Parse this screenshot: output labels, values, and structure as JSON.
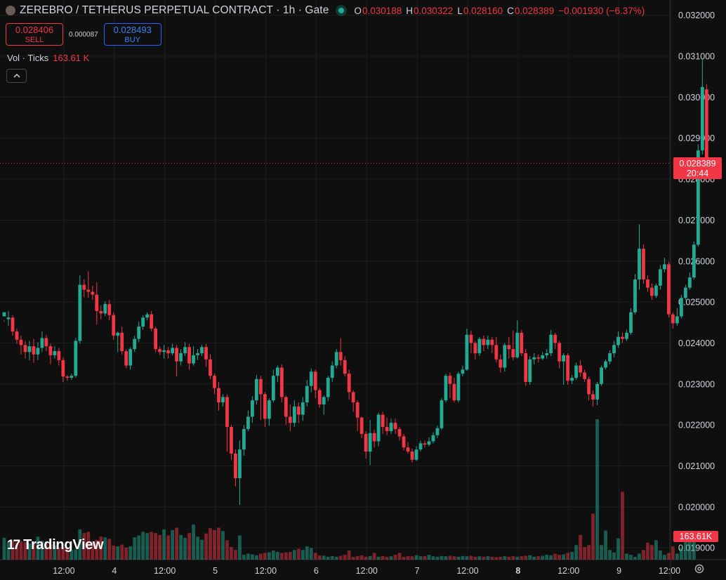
{
  "header": {
    "title": "ZEREBRO / TETHERUS PERPETUAL CONTRACT · 1h · Gate",
    "ohlc": {
      "o_label": "O",
      "o": "0.030188",
      "h_label": "H",
      "h": "0.030322",
      "l_label": "L",
      "l": "0.028160",
      "c_label": "C",
      "c": "0.028389",
      "change": "−0.001930 (−6.37%)"
    }
  },
  "trade": {
    "sell_price": "0.028406",
    "sell_label": "SELL",
    "spread": "0.000087",
    "buy_price": "0.028493",
    "buy_label": "BUY"
  },
  "volume_legend": {
    "label": "Vol · Ticks",
    "value": "163.61 K"
  },
  "collapse_icon": "chevron-up-icon",
  "last_price": {
    "price": "0.028389",
    "countdown": "20:44"
  },
  "volume_tag": "163.61K",
  "branding": {
    "name": "TradingView",
    "mark": "17"
  },
  "colors": {
    "up": "#22ab94",
    "down": "#f23645",
    "background": "#0f0f0f",
    "grid": "#1e1e1e",
    "buy": "#2962ff"
  },
  "chart_data": {
    "type": "candlestick",
    "title": "ZEREBRO / TETHERUS PERPETUAL CONTRACT · 1h · Gate",
    "ylim": [
      0.0188,
      0.0322
    ],
    "y_ticks": [
      "0.032000",
      "0.031000",
      "0.030000",
      "0.029000",
      "0.028000",
      "0.027000",
      "0.026000",
      "0.025000",
      "0.024000",
      "0.023000",
      "0.022000",
      "0.021000",
      "0.020000",
      "0.019000"
    ],
    "x_ticks": [
      {
        "label": "12:00",
        "index": 7,
        "bold": false
      },
      {
        "label": "4",
        "index": 19,
        "bold": false
      },
      {
        "label": "12:00",
        "index": 31,
        "bold": false
      },
      {
        "label": "5",
        "index": 43,
        "bold": false
      },
      {
        "label": "12:00",
        "index": 55,
        "bold": false
      },
      {
        "label": "6",
        "index": 67,
        "bold": false
      },
      {
        "label": "12:00",
        "index": 79,
        "bold": false
      },
      {
        "label": "7",
        "index": 91,
        "bold": false
      },
      {
        "label": "12:00",
        "index": 103,
        "bold": false
      },
      {
        "label": "8",
        "index": 115,
        "bold": true
      },
      {
        "label": "12:00",
        "index": 127,
        "bold": false
      },
      {
        "label": "9",
        "index": 139,
        "bold": false
      },
      {
        "label": "12:00",
        "index": 151,
        "bold": false
      }
    ],
    "last_price": 0.028389,
    "candles": [
      [
        0.02465,
        0.02475,
        0.02455,
        0.02452
      ],
      [
        0.02458,
        0.02462,
        0.02478,
        0.02442
      ],
      [
        0.02462,
        0.02428,
        0.02468,
        0.02418
      ],
      [
        0.02428,
        0.02408,
        0.02435,
        0.02398
      ],
      [
        0.02408,
        0.02395,
        0.02418,
        0.02372
      ],
      [
        0.02395,
        0.02378,
        0.02405,
        0.02362
      ],
      [
        0.02378,
        0.02392,
        0.02405,
        0.02358
      ],
      [
        0.02392,
        0.02372,
        0.0241,
        0.02352
      ],
      [
        0.02372,
        0.02388,
        0.02402,
        0.02358
      ],
      [
        0.02388,
        0.02412,
        0.02428,
        0.02378
      ],
      [
        0.02412,
        0.02392,
        0.0242,
        0.0238
      ],
      [
        0.02392,
        0.0237,
        0.02398,
        0.02348
      ],
      [
        0.0237,
        0.0238,
        0.02392,
        0.02362
      ],
      [
        0.0238,
        0.02358,
        0.02388,
        0.02345
      ],
      [
        0.02358,
        0.02318,
        0.02365,
        0.02305
      ],
      [
        0.02318,
        0.02315,
        0.02322,
        0.02308
      ],
      [
        0.02315,
        0.0232,
        0.02325,
        0.0231
      ],
      [
        0.0232,
        0.02405,
        0.02412,
        0.02315
      ],
      [
        0.02405,
        0.02542,
        0.02565,
        0.02398
      ],
      [
        0.02542,
        0.0253,
        0.02555,
        0.02512
      ],
      [
        0.0253,
        0.02525,
        0.02575,
        0.0251
      ],
      [
        0.02525,
        0.02518,
        0.0254,
        0.02505
      ],
      [
        0.02518,
        0.02478,
        0.02548,
        0.02445
      ],
      [
        0.02478,
        0.02472,
        0.02492,
        0.02458
      ],
      [
        0.02472,
        0.02495,
        0.02502,
        0.02465
      ],
      [
        0.02495,
        0.02468,
        0.02505,
        0.02455
      ],
      [
        0.02468,
        0.02418,
        0.02475,
        0.02408
      ],
      [
        0.02418,
        0.02425,
        0.02428,
        0.02378
      ],
      [
        0.02425,
        0.0238,
        0.0244,
        0.02372
      ],
      [
        0.0238,
        0.02345,
        0.02385,
        0.02338
      ],
      [
        0.02345,
        0.02385,
        0.0239,
        0.02335
      ],
      [
        0.02385,
        0.0241,
        0.02418,
        0.02378
      ],
      [
        0.0241,
        0.0244,
        0.02452,
        0.02402
      ],
      [
        0.0244,
        0.02462,
        0.02468,
        0.02432
      ],
      [
        0.02462,
        0.0247,
        0.02475,
        0.02455
      ],
      [
        0.0247,
        0.02435,
        0.02478,
        0.02428
      ],
      [
        0.02435,
        0.02385,
        0.0244,
        0.02378
      ],
      [
        0.02385,
        0.02378,
        0.02392,
        0.0237
      ],
      [
        0.02378,
        0.02382,
        0.02395,
        0.02362
      ],
      [
        0.02382,
        0.02375,
        0.0239,
        0.02362
      ],
      [
        0.02375,
        0.02388,
        0.02398,
        0.0237
      ],
      [
        0.02388,
        0.02355,
        0.02395,
        0.02318
      ],
      [
        0.02355,
        0.02375,
        0.02385,
        0.02345
      ],
      [
        0.02375,
        0.0239,
        0.02402,
        0.02368
      ],
      [
        0.0239,
        0.0235,
        0.02398,
        0.02335
      ],
      [
        0.0235,
        0.0237,
        0.02392,
        0.02345
      ],
      [
        0.0237,
        0.02375,
        0.02385,
        0.02358
      ],
      [
        0.02375,
        0.0239,
        0.02395,
        0.02368
      ],
      [
        0.0239,
        0.0236,
        0.02398,
        0.02342
      ],
      [
        0.0236,
        0.0232,
        0.02372,
        0.02312
      ],
      [
        0.0232,
        0.0229,
        0.02325,
        0.02275
      ],
      [
        0.0229,
        0.02255,
        0.02305,
        0.02235
      ],
      [
        0.02255,
        0.02268,
        0.02275,
        0.02245
      ],
      [
        0.02268,
        0.02195,
        0.02275,
        0.02135
      ],
      [
        0.02195,
        0.0213,
        0.022,
        0.02115
      ],
      [
        0.0213,
        0.0207,
        0.0214,
        0.0205
      ],
      [
        0.0207,
        0.0214,
        0.02162,
        0.02005
      ],
      [
        0.0214,
        0.0219,
        0.022,
        0.02125
      ],
      [
        0.0219,
        0.0222,
        0.02235,
        0.02185
      ],
      [
        0.0222,
        0.0226,
        0.0227,
        0.02205
      ],
      [
        0.0226,
        0.02312,
        0.02322,
        0.0225
      ],
      [
        0.02312,
        0.02275,
        0.0232,
        0.02212
      ],
      [
        0.02275,
        0.02215,
        0.0228,
        0.02195
      ],
      [
        0.02215,
        0.0226,
        0.02265,
        0.02198
      ],
      [
        0.0226,
        0.0232,
        0.02335,
        0.02255
      ],
      [
        0.0232,
        0.0234,
        0.02345,
        0.02305
      ],
      [
        0.0234,
        0.02268,
        0.02348,
        0.02255
      ],
      [
        0.02268,
        0.0222,
        0.02272,
        0.022
      ],
      [
        0.0222,
        0.02205,
        0.0225,
        0.02185
      ],
      [
        0.02205,
        0.02245,
        0.0226,
        0.02195
      ],
      [
        0.02245,
        0.02225,
        0.02255,
        0.02205
      ],
      [
        0.02225,
        0.02255,
        0.02268,
        0.0221
      ],
      [
        0.02255,
        0.02295,
        0.0231,
        0.02245
      ],
      [
        0.02295,
        0.0233,
        0.02338,
        0.0228
      ],
      [
        0.0233,
        0.02285,
        0.02335,
        0.02265
      ],
      [
        0.02285,
        0.0225,
        0.0229,
        0.02242
      ],
      [
        0.0225,
        0.02268,
        0.02272,
        0.02225
      ],
      [
        0.02268,
        0.02315,
        0.0232,
        0.02258
      ],
      [
        0.02315,
        0.02345,
        0.02355,
        0.02305
      ],
      [
        0.02345,
        0.02378,
        0.02385,
        0.02338
      ],
      [
        0.02378,
        0.02358,
        0.02412,
        0.02345
      ],
      [
        0.02358,
        0.02325,
        0.02368,
        0.02318
      ],
      [
        0.02325,
        0.0228,
        0.02335,
        0.02262
      ],
      [
        0.0228,
        0.02255,
        0.02285,
        0.02232
      ],
      [
        0.02255,
        0.02218,
        0.0226,
        0.02185
      ],
      [
        0.02218,
        0.02178,
        0.0222,
        0.02168
      ],
      [
        0.02178,
        0.02135,
        0.02185,
        0.02118
      ],
      [
        0.02135,
        0.0218,
        0.02212,
        0.02102
      ],
      [
        0.0218,
        0.0216,
        0.02188,
        0.02145
      ],
      [
        0.0216,
        0.02225,
        0.0223,
        0.02148
      ],
      [
        0.02225,
        0.02195,
        0.02232,
        0.02178
      ],
      [
        0.02195,
        0.02185,
        0.02218,
        0.02175
      ],
      [
        0.02185,
        0.02205,
        0.02215,
        0.02178
      ],
      [
        0.02205,
        0.0219,
        0.02215,
        0.02178
      ],
      [
        0.0219,
        0.02172,
        0.02195,
        0.02162
      ],
      [
        0.02172,
        0.02145,
        0.02178,
        0.02138
      ],
      [
        0.02145,
        0.02135,
        0.02158,
        0.0213
      ],
      [
        0.02135,
        0.02115,
        0.02142,
        0.02108
      ],
      [
        0.02115,
        0.0214,
        0.02148,
        0.02112
      ],
      [
        0.0214,
        0.02155,
        0.02162,
        0.02135
      ],
      [
        0.02155,
        0.02152,
        0.02162,
        0.02145
      ],
      [
        0.02152,
        0.0216,
        0.0217,
        0.02148
      ],
      [
        0.0216,
        0.02175,
        0.02182,
        0.02155
      ],
      [
        0.02175,
        0.02192,
        0.02198,
        0.02168
      ],
      [
        0.02192,
        0.0226,
        0.02265,
        0.02188
      ],
      [
        0.0226,
        0.0232,
        0.02325,
        0.02255
      ],
      [
        0.0232,
        0.023,
        0.02328,
        0.02265
      ],
      [
        0.023,
        0.0226,
        0.02315,
        0.02255
      ],
      [
        0.0226,
        0.02325,
        0.0233,
        0.02255
      ],
      [
        0.02325,
        0.02335,
        0.02345,
        0.02318
      ],
      [
        0.02335,
        0.0242,
        0.02435,
        0.02332
      ],
      [
        0.0242,
        0.024,
        0.0243,
        0.02375
      ],
      [
        0.024,
        0.02375,
        0.02405,
        0.0236
      ],
      [
        0.02375,
        0.0241,
        0.02415,
        0.02368
      ],
      [
        0.0241,
        0.02395,
        0.02418,
        0.0238
      ],
      [
        0.02395,
        0.02408,
        0.02418,
        0.02385
      ],
      [
        0.02408,
        0.02395,
        0.02415,
        0.02375
      ],
      [
        0.02395,
        0.0236,
        0.02415,
        0.02352
      ],
      [
        0.0236,
        0.0234,
        0.02372,
        0.02328
      ],
      [
        0.0234,
        0.02395,
        0.024,
        0.0233
      ],
      [
        0.02395,
        0.02385,
        0.02415,
        0.02362
      ],
      [
        0.02385,
        0.02365,
        0.0243,
        0.02358
      ],
      [
        0.02365,
        0.02425,
        0.02455,
        0.02362
      ],
      [
        0.02425,
        0.02375,
        0.02432,
        0.02368
      ],
      [
        0.02375,
        0.02305,
        0.02385,
        0.02295
      ],
      [
        0.02305,
        0.0236,
        0.02368,
        0.02298
      ],
      [
        0.0236,
        0.02365,
        0.02375,
        0.02348
      ],
      [
        0.02365,
        0.02362,
        0.02372,
        0.02352
      ],
      [
        0.02362,
        0.0237,
        0.02378,
        0.02358
      ],
      [
        0.0237,
        0.02375,
        0.02385,
        0.02362
      ],
      [
        0.02375,
        0.0242,
        0.02432,
        0.02368
      ],
      [
        0.0242,
        0.024,
        0.02425,
        0.02385
      ],
      [
        0.024,
        0.02355,
        0.02405,
        0.02338
      ],
      [
        0.02355,
        0.0237,
        0.02375,
        0.02298
      ],
      [
        0.0237,
        0.02308,
        0.02375,
        0.02298
      ],
      [
        0.02308,
        0.02315,
        0.02322,
        0.023
      ],
      [
        0.02315,
        0.02345,
        0.02352,
        0.0231
      ],
      [
        0.02345,
        0.02328,
        0.02358,
        0.02318
      ],
      [
        0.02328,
        0.02312,
        0.02335,
        0.02305
      ],
      [
        0.02312,
        0.02275,
        0.02318,
        0.0226
      ],
      [
        0.02275,
        0.02262,
        0.02285,
        0.02245
      ],
      [
        0.02262,
        0.023,
        0.02305,
        0.02248
      ],
      [
        0.023,
        0.0234,
        0.02345,
        0.02295
      ],
      [
        0.0234,
        0.02355,
        0.0236,
        0.02335
      ],
      [
        0.02355,
        0.02375,
        0.02382,
        0.02348
      ],
      [
        0.02375,
        0.02395,
        0.02405,
        0.02365
      ],
      [
        0.02395,
        0.02415,
        0.02428,
        0.02388
      ],
      [
        0.02415,
        0.0241,
        0.02425,
        0.024
      ],
      [
        0.0241,
        0.02425,
        0.02432,
        0.02405
      ],
      [
        0.02425,
        0.02475,
        0.02485,
        0.0242
      ],
      [
        0.02475,
        0.02555,
        0.02568,
        0.0247
      ],
      [
        0.02555,
        0.0263,
        0.0269,
        0.0253
      ],
      [
        0.0263,
        0.02555,
        0.0264,
        0.02545
      ],
      [
        0.02555,
        0.02535,
        0.02565,
        0.02525
      ],
      [
        0.02535,
        0.02515,
        0.02545,
        0.02505
      ],
      [
        0.02515,
        0.0254,
        0.02545,
        0.0251
      ],
      [
        0.0254,
        0.0258,
        0.0259,
        0.0253
      ],
      [
        0.0258,
        0.02592,
        0.02608,
        0.02572
      ],
      [
        0.02592,
        0.0247,
        0.02598,
        0.02462
      ],
      [
        0.0247,
        0.02448,
        0.02475,
        0.02435
      ],
      [
        0.02448,
        0.02465,
        0.02485,
        0.02442
      ],
      [
        0.02465,
        0.0251,
        0.02518,
        0.0246
      ],
      [
        0.0251,
        0.02535,
        0.02542,
        0.02505
      ],
      [
        0.02535,
        0.0256,
        0.02572,
        0.0253
      ],
      [
        0.0256,
        0.0264,
        0.02648,
        0.02555
      ],
      [
        0.0264,
        0.0287,
        0.02885,
        0.02635
      ],
      [
        0.0287,
        0.03025,
        0.03095,
        0.0286
      ],
      [
        0.03019,
        0.02839,
        0.03032,
        0.02816
      ]
    ],
    "volumes": [
      90,
      72,
      78,
      72,
      75,
      72,
      67,
      70,
      95,
      78,
      70,
      62,
      58,
      52,
      50,
      45,
      42,
      42,
      125,
      110,
      115,
      75,
      82,
      95,
      92,
      86,
      58,
      55,
      62,
      50,
      55,
      92,
      100,
      115,
      110,
      115,
      110,
      102,
      125,
      100,
      122,
      132,
      102,
      90,
      110,
      145,
      95,
      82,
      108,
      130,
      122,
      132,
      118,
      80,
      52,
      40,
      100,
      20,
      25,
      22,
      18,
      25,
      28,
      30,
      38,
      32,
      28,
      30,
      32,
      40,
      45,
      40,
      55,
      48,
      28,
      18,
      16,
      12,
      15,
      12,
      16,
      20,
      38,
      12,
      15,
      18,
      12,
      15,
      28,
      12,
      15,
      12,
      14,
      20,
      28,
      12,
      15,
      14,
      18,
      14,
      15,
      20,
      14,
      12,
      15,
      14,
      16,
      14,
      12,
      15,
      14,
      16,
      12,
      14,
      12,
      14,
      12,
      10,
      12,
      14,
      12,
      14,
      12,
      14,
      16,
      18,
      12,
      14,
      16,
      20,
      18,
      24,
      20,
      22,
      28,
      32,
      60,
      102,
      52,
      60,
      190,
      580,
      60,
      120,
      40,
      30,
      88,
      280,
      25,
      20,
      12,
      25,
      40,
      70,
      60,
      80,
      38,
      20,
      28,
      55,
      25,
      48,
      75,
      110,
      88
    ]
  }
}
